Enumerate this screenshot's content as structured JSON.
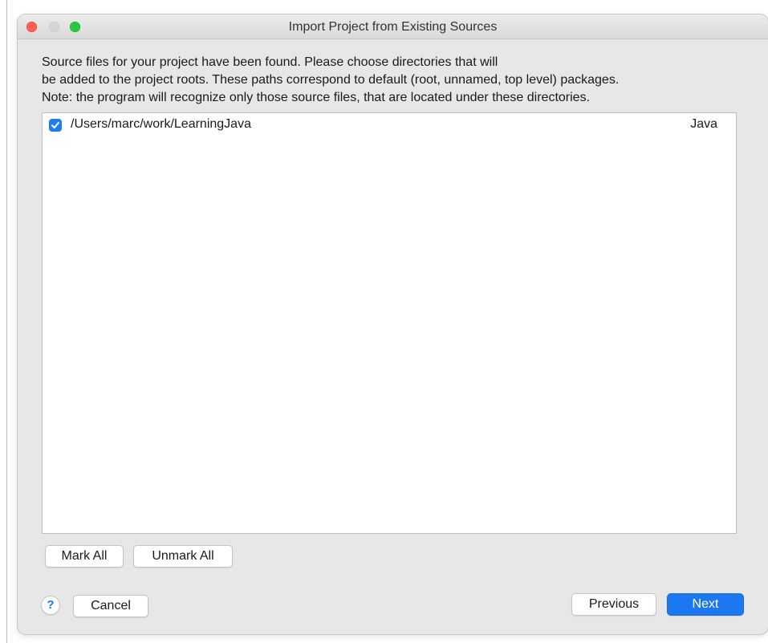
{
  "window": {
    "title": "Import Project from Existing Sources"
  },
  "description": {
    "line1": "Source files for your project have been found. Please choose directories that will",
    "line2": "be added to the project roots. These paths correspond to default (root, unnamed, top level) packages.",
    "line3": "Note: the program will recognize only those source files, that are located under these directories."
  },
  "roots": [
    {
      "checked": true,
      "path": "/Users/marc/work/LearningJava",
      "type": "Java"
    }
  ],
  "buttons": {
    "mark_all": "Mark All",
    "unmark_all": "Unmark All",
    "help": "?",
    "cancel": "Cancel",
    "previous": "Previous",
    "next": "Next"
  },
  "colors": {
    "accent": "#1b78f0",
    "traffic_close": "#fe5f57",
    "traffic_min": "#d6d6d6",
    "traffic_max": "#28c840"
  }
}
